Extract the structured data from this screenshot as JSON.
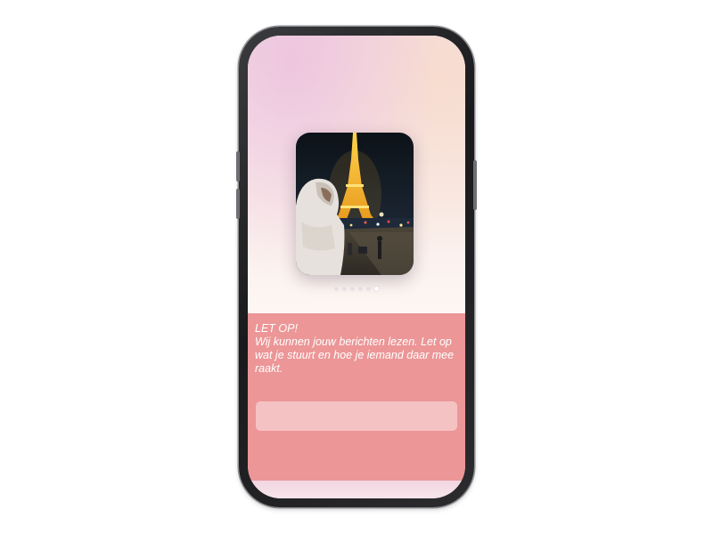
{
  "story": {
    "photo_icon": "eiffel-tower-night-photo",
    "pager": {
      "total": 6,
      "active_index": 5
    }
  },
  "warning": {
    "title": "LET OP!",
    "body": "Wij kunnen jouw berichten lezen. Let op wat je stuurt en hoe je iemand daar mee raakt.",
    "background_color": "#ec9697"
  },
  "reply_input": {
    "placeholder": ""
  },
  "colors": {
    "accent": "#ec9697",
    "input_fill": "#f5c2c4"
  }
}
